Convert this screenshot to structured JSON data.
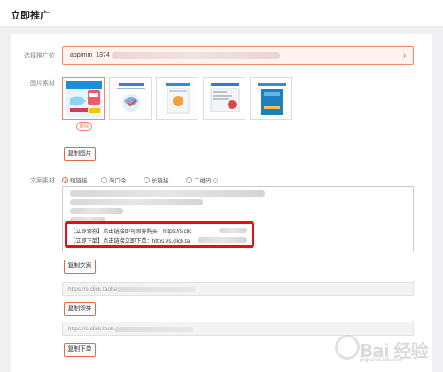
{
  "header": {
    "title": "立即推广"
  },
  "form": {
    "placement_label": "选择推广位",
    "placement_value": "app/mm_1374",
    "images_label": "图片素材",
    "delete_tag": "删除",
    "copy_image_button": "复制图片",
    "copy_label": "文案素材",
    "link_types": [
      "短链接",
      "淘口令",
      "长链接",
      "二维码"
    ],
    "selected_link_type": "短链接",
    "copy_text": {
      "line_coupon": "【立即领券】点击链接即可领券购买：https://s.clic",
      "line_order": "【立即下单】点击链接立即下单：https://s.click.ta"
    },
    "copy_text_button": "复制文案",
    "coupon_link": "https://s.click.taoba",
    "copy_coupon_button": "复制领券",
    "order_link": "https://s.click.taob",
    "copy_order_button": "复制下单"
  },
  "watermark": {
    "big": "Bai 经验",
    "small": "jingyan.baidu.com"
  },
  "colors": {
    "accent": "#e06a4c",
    "highlight": "#e3101a",
    "selected_bg": "#fff2ef"
  }
}
